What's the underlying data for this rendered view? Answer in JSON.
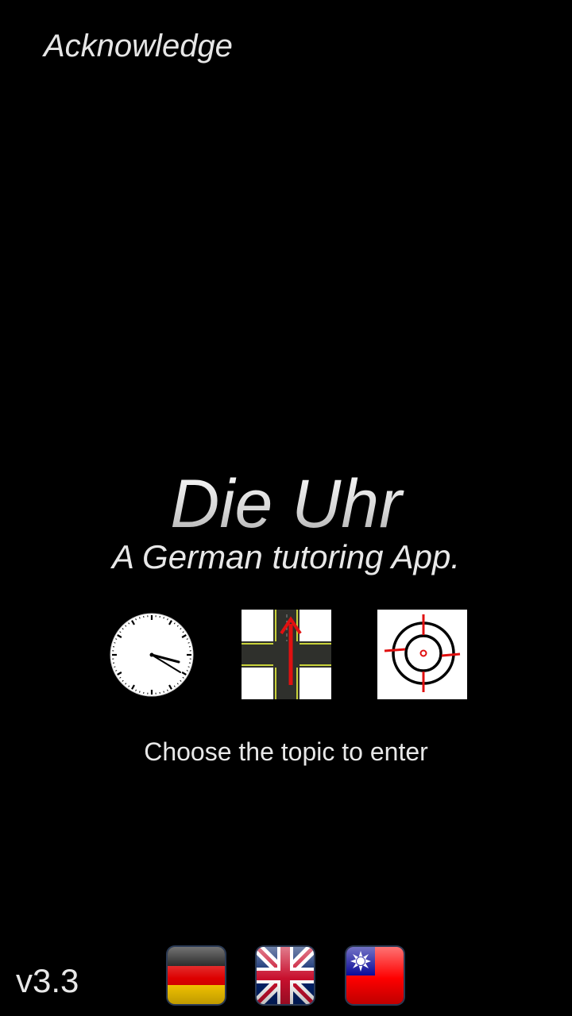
{
  "header": {
    "acknowledge_label": "Acknowledge"
  },
  "app": {
    "title": "Die Uhr",
    "subtitle": "A German tutoring App."
  },
  "topics": [
    {
      "name": "clock-topic",
      "icon": "clock-icon"
    },
    {
      "name": "crossroad-topic",
      "icon": "crossroad-arrow-icon"
    },
    {
      "name": "target-topic",
      "icon": "target-icon"
    }
  ],
  "prompt": "Choose the topic to enter",
  "footer": {
    "version": "v3.3",
    "languages": [
      {
        "name": "german-flag",
        "icon": "german-flag-icon"
      },
      {
        "name": "uk-flag",
        "icon": "uk-flag-icon"
      },
      {
        "name": "taiwan-flag",
        "icon": "taiwan-flag-icon"
      }
    ]
  },
  "colors": {
    "background": "#000000",
    "text": "#e8e8e8",
    "accent_red": "#e01010"
  }
}
